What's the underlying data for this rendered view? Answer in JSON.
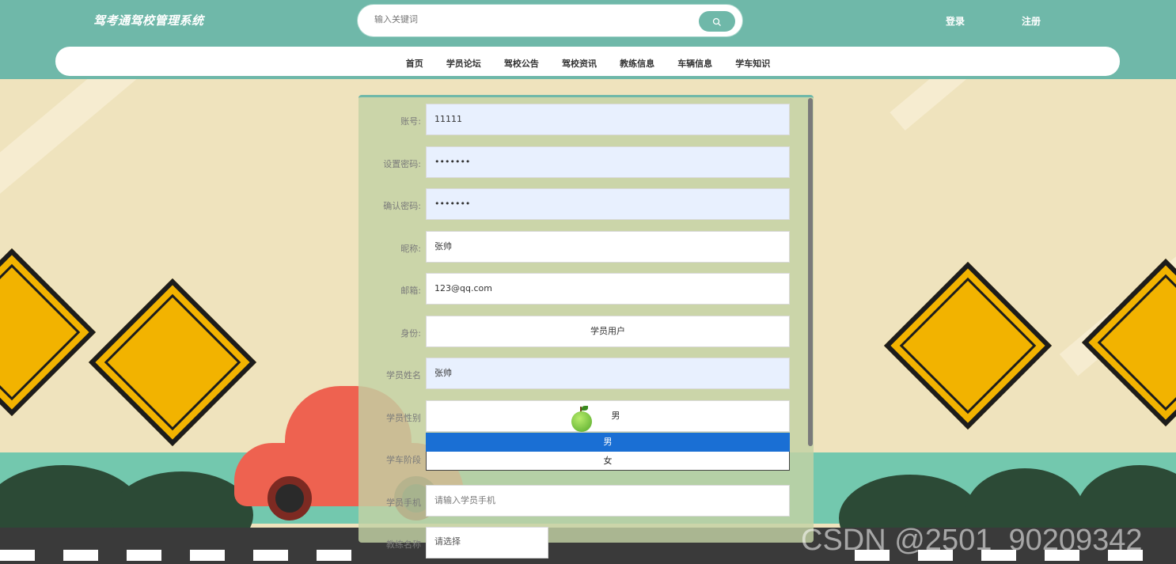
{
  "header": {
    "logo": "驾考通驾校管理系统",
    "search_placeholder": "输入关键词",
    "search_icon": "search-icon",
    "login": "登录",
    "register": "注册"
  },
  "nav": [
    "首页",
    "学员论坛",
    "驾校公告",
    "驾校资讯",
    "教练信息",
    "车辆信息",
    "学车知识"
  ],
  "form": {
    "account_label": "账号:",
    "account_value": "11111",
    "password_label": "设置密码:",
    "password_value": "•••••••",
    "confirm_label": "确认密码:",
    "confirm_value": "•••••••",
    "nickname_label": "昵称:",
    "nickname_value": "张帅",
    "email_label": "邮箱:",
    "email_value": "123@qq.com",
    "role_label": "身份:",
    "role_value": "学员用户",
    "name_label": "学员姓名",
    "name_value": "张帅",
    "gender_label": "学员性别",
    "gender_value": "男",
    "gender_options": [
      "男",
      "女"
    ],
    "stage_label": "学车阶段",
    "phone_label": "学员手机",
    "phone_placeholder": "请输入学员手机",
    "coach_label": "教练名称",
    "coach_placeholder": "请选择"
  },
  "watermark": "CSDN @2501_90209342",
  "colors": {
    "accent": "#6fb8a9",
    "autofill": "#e8f0fe",
    "selected": "#1a6fd4"
  }
}
